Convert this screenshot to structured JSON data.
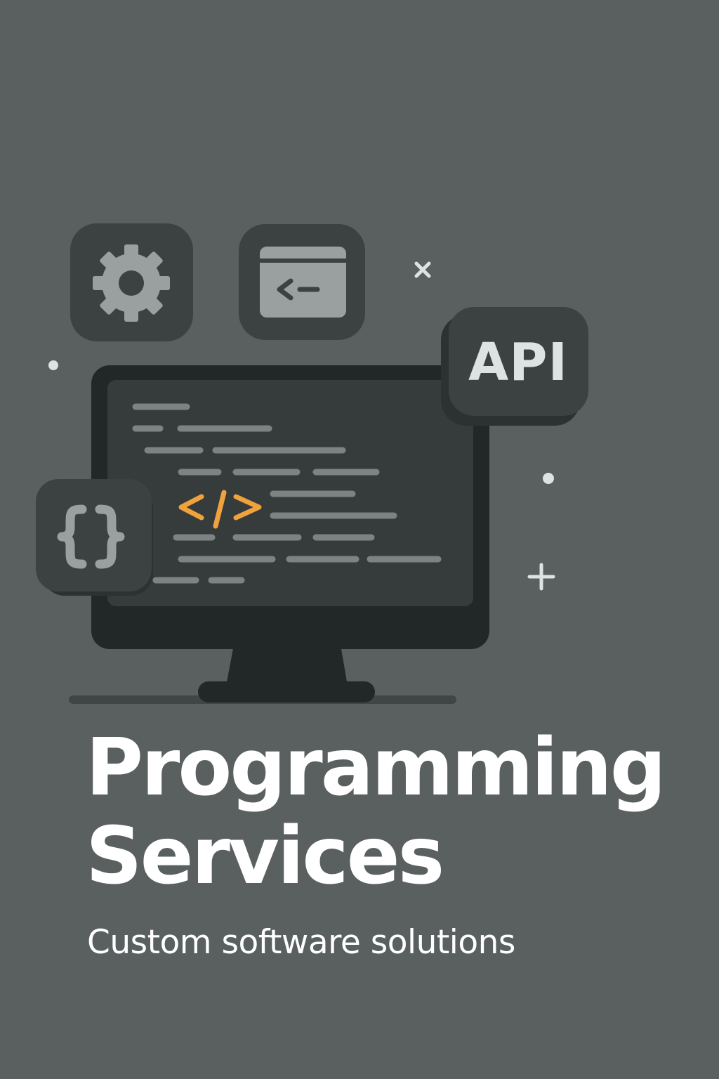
{
  "hero": {
    "api_badge_label": "API",
    "code_tag_glyph": "</>",
    "braces_glyph": "{}",
    "icons": [
      "gear-icon",
      "terminal-window-icon",
      "api-badge",
      "curly-braces-icon",
      "code-tag-icon",
      "close-icon",
      "plus-icon"
    ]
  },
  "title": {
    "line1": "Programming",
    "line2": "Services"
  },
  "subtitle": "Custom software solutions",
  "colors": {
    "background": "#5a5f5f",
    "tile": "#3c4141",
    "monitor_frame": "#222727",
    "screen": "#363c3c",
    "code_line": "#7d8383",
    "accent": "#f0a23c",
    "text": "#ffffff"
  }
}
